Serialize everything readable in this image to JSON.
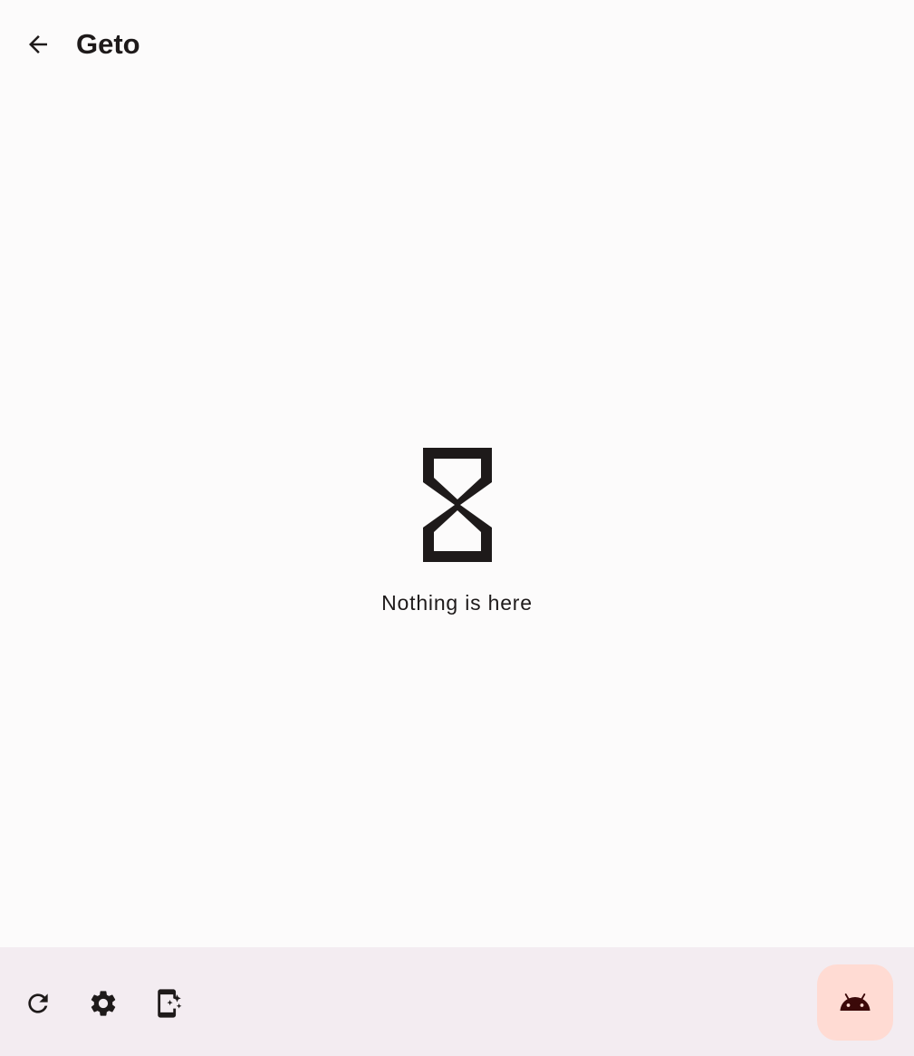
{
  "app_bar": {
    "title": "Geto",
    "back_icon": "arrow-back-icon"
  },
  "empty_state": {
    "icon": "hourglass-empty-icon",
    "message": "Nothing is here"
  },
  "bottom_bar": {
    "actions": [
      {
        "icon": "refresh-icon"
      },
      {
        "icon": "settings-icon"
      },
      {
        "icon": "app-shortcut-icon"
      }
    ],
    "fab_icon": "android-icon"
  },
  "colors": {
    "background": "#FCFBFB",
    "bottom_bar": "#F3ECF1",
    "fab": "#FFDBD3",
    "on_surface": "#1E1A1A",
    "fab_icon": "#3B0909"
  }
}
